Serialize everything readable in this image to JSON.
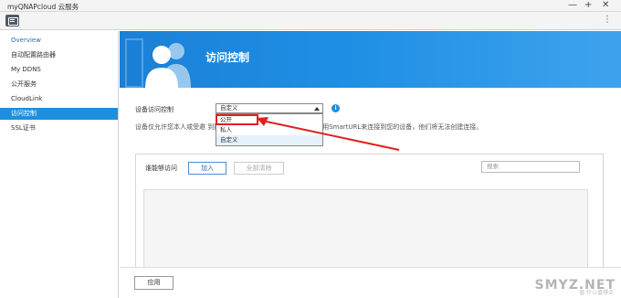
{
  "window": {
    "title": "myQNAPcloud 云服务",
    "minimize": "—",
    "maximize": "+",
    "close": "✕"
  },
  "toolbar": {
    "more": "⋮"
  },
  "sidebar": {
    "items": [
      {
        "label": "Overview"
      },
      {
        "label": "自动配置路由器"
      },
      {
        "label": "My DDNS"
      },
      {
        "label": "公开服务"
      },
      {
        "label": "CloudLink"
      },
      {
        "label": "访问控制"
      },
      {
        "label": "SSL证书"
      }
    ],
    "active_index": 5
  },
  "banner": {
    "title": "访问控制"
  },
  "access": {
    "label": "设备访问控制",
    "selected": "自定义",
    "options": [
      "公开",
      "私人",
      "自定义"
    ],
    "highlighted_index": 2,
    "description": "设备仅允许您本人或受邀 到搜索结果。如果有未受邀请的人尝试使用SmartURL来连接到您的设备，他们将无法创建连接。"
  },
  "panel": {
    "label": "谁能够访问",
    "add": "加入",
    "clear_all": "全部清除",
    "search_placeholder": "搜索"
  },
  "footer": {
    "apply": "应用"
  },
  "watermark": {
    "main": "SMYZ.NET",
    "sub": "值 什么值得买"
  },
  "colors": {
    "accent": "#1e8fde",
    "highlight_box": "#e02020"
  }
}
